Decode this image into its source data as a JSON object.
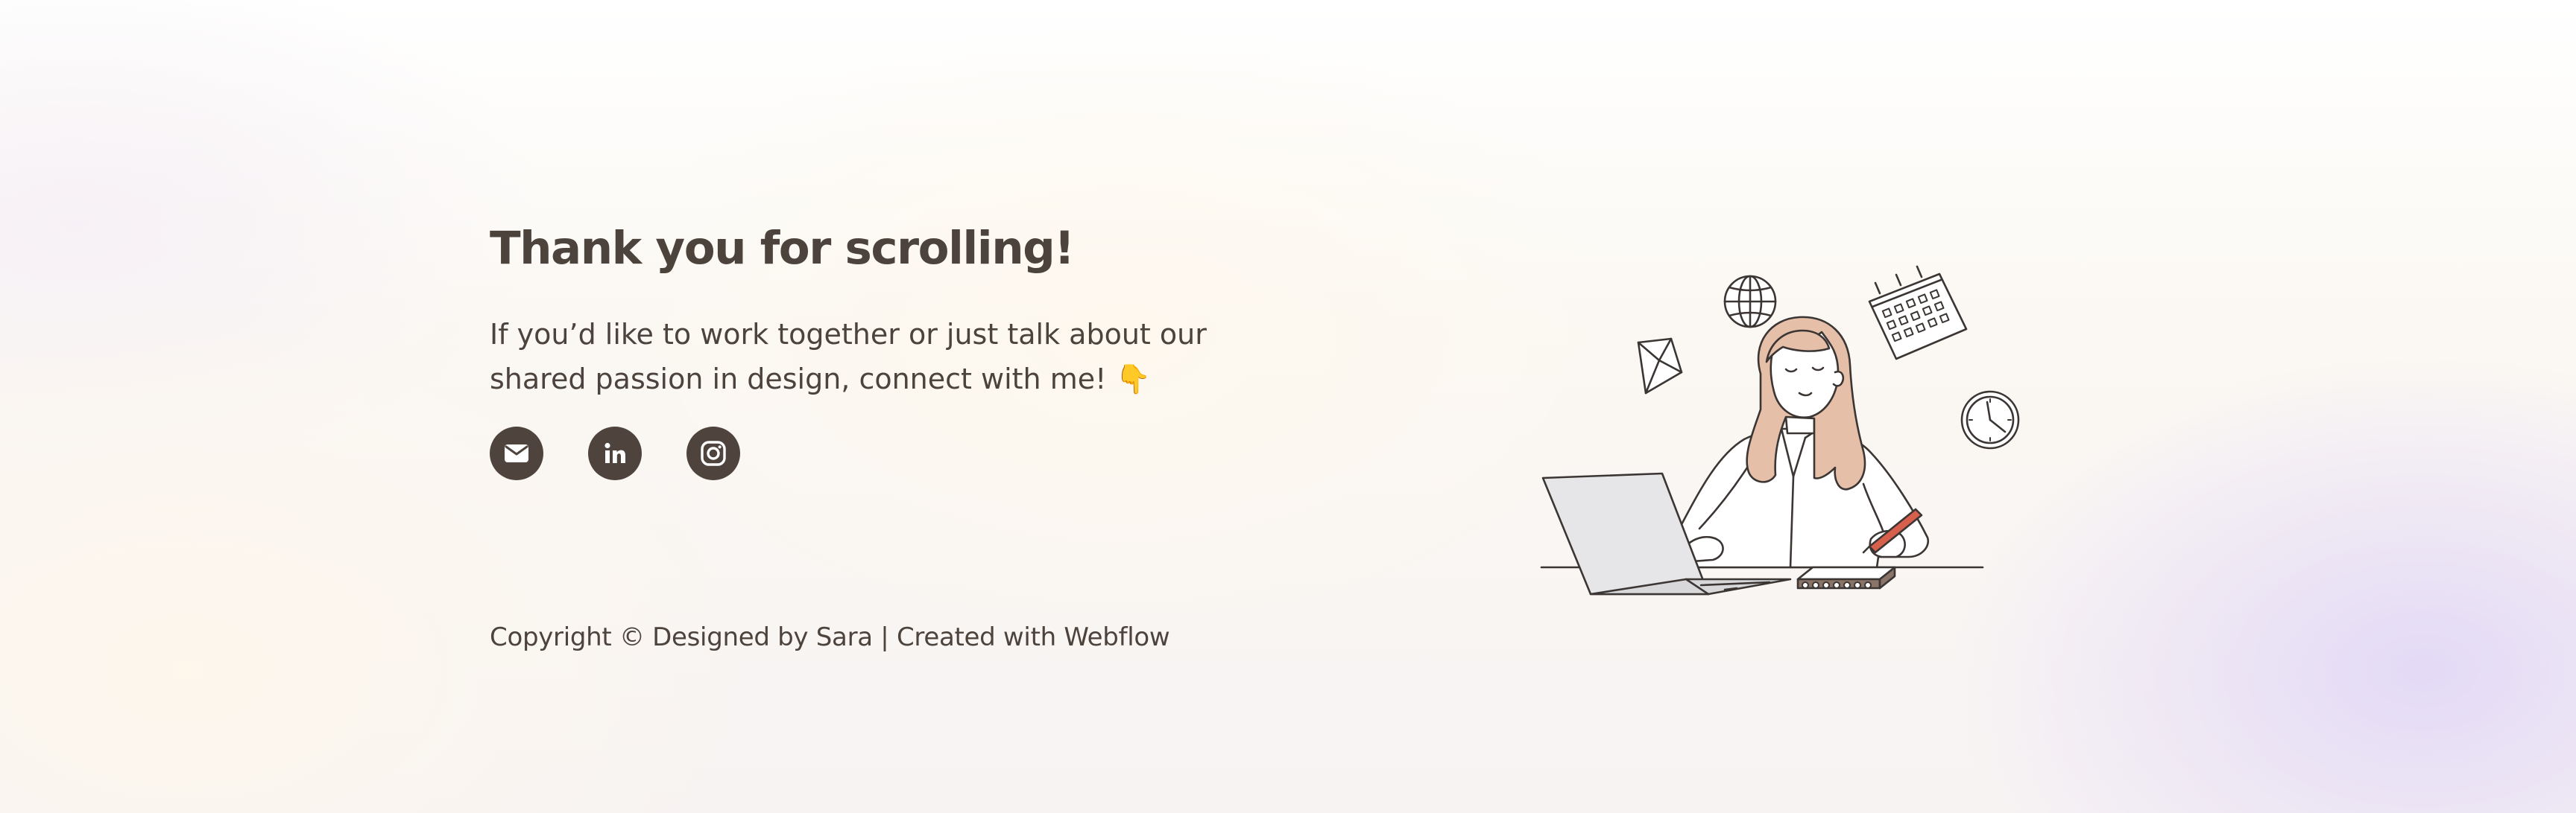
{
  "contact": {
    "heading": "Thank you for scrolling!",
    "intro_line1": "If you’d like to work together or just talk about our",
    "intro_line2": "shared passion in design, connect with me!",
    "pointing_emoji": "👇",
    "social": [
      {
        "name": "email",
        "icon": "envelope-icon"
      },
      {
        "name": "linkedin",
        "icon": "linkedin-icon"
      },
      {
        "name": "instagram",
        "icon": "instagram-icon"
      }
    ]
  },
  "footer": {
    "copyright": "Copyright © Designed by Sara | Created with Webflow"
  },
  "illustration": {
    "subject": "woman-working-at-laptop-illustration"
  },
  "colors": {
    "text": "#4d433d",
    "icon_bg": "#4e433d",
    "hair": "#e5bfa8",
    "accent_red": "#d6604c"
  }
}
